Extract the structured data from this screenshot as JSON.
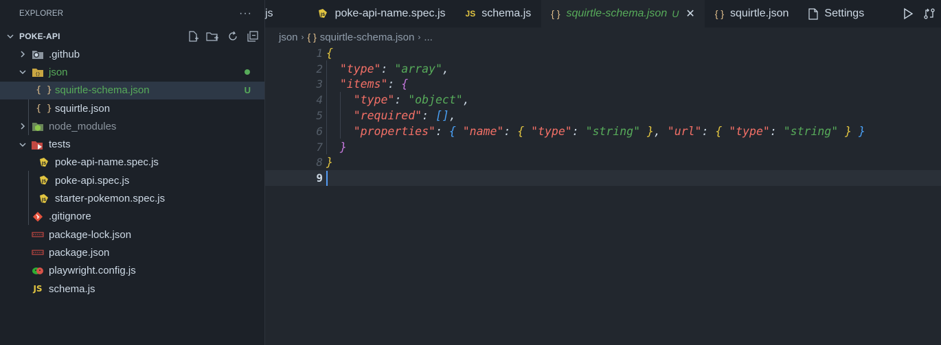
{
  "explorer": {
    "title": "EXPLORER",
    "more": "···",
    "project": "POKE-API"
  },
  "tree": [
    {
      "label": ".github",
      "kind": "folder",
      "icon": "github-folder-icon",
      "indent": 0,
      "twisty": "›"
    },
    {
      "label": "json",
      "kind": "folder-open",
      "icon": "json-folder-icon",
      "indent": 0,
      "twisty": "⌄",
      "status": "dot"
    },
    {
      "label": "squirtle-schema.json",
      "kind": "file",
      "icon": "json-file-icon",
      "indent": 1,
      "status": "U",
      "selected": true
    },
    {
      "label": "squirtle.json",
      "kind": "file",
      "icon": "json-file-icon",
      "indent": 1
    },
    {
      "label": "node_modules",
      "kind": "folder",
      "icon": "node-folder-icon",
      "indent": 0,
      "twisty": "›",
      "dim": true
    },
    {
      "label": "tests",
      "kind": "folder-open",
      "icon": "tests-folder-icon",
      "indent": 0,
      "twisty": "⌄"
    },
    {
      "label": "poke-api-name.spec.js",
      "kind": "file",
      "icon": "spec-file-icon",
      "indent": 1
    },
    {
      "label": "poke-api.spec.js",
      "kind": "file",
      "icon": "spec-file-icon",
      "indent": 1
    },
    {
      "label": "starter-pokemon.spec.js",
      "kind": "file",
      "icon": "spec-file-icon",
      "indent": 1
    },
    {
      "label": ".gitignore",
      "kind": "file",
      "icon": "git-file-icon",
      "indent": 0
    },
    {
      "label": "package-lock.json",
      "kind": "file",
      "icon": "npm-file-icon",
      "indent": 0
    },
    {
      "label": "package.json",
      "kind": "file",
      "icon": "npm-file-icon",
      "indent": 0
    },
    {
      "label": "playwright.config.js",
      "kind": "file",
      "icon": "playwright-file-icon",
      "indent": 0
    },
    {
      "label": "schema.js",
      "kind": "file",
      "icon": "js-file-icon",
      "indent": 0
    }
  ],
  "tabs": [
    {
      "label": "js",
      "icon": "",
      "partial": true
    },
    {
      "label": "poke-api-name.spec.js",
      "icon": "spec-file-icon"
    },
    {
      "label": "schema.js",
      "icon": "js-file-icon",
      "icon_text": "JS"
    },
    {
      "label": "squirtle-schema.json",
      "icon": "json-file-icon",
      "icon_text": "{ }",
      "active": true,
      "status": "U",
      "close": "✕"
    },
    {
      "label": "squirtle.json",
      "icon": "json-file-icon",
      "icon_text": "{ }"
    },
    {
      "label": "Settings",
      "icon": "settings-file-icon"
    }
  ],
  "breadcrumb": {
    "folder": "json",
    "file_icon": "{ }",
    "file": "squirtle-schema.json",
    "more": "..."
  },
  "editor": {
    "line_numbers": [
      "1",
      "2",
      "3",
      "4",
      "5",
      "6",
      "7",
      "8",
      "9"
    ],
    "active_line": "9"
  },
  "colors": {
    "key": "#f47067",
    "string": "#57ab5a",
    "bracket1": "#e2c541",
    "bracket2": "#c678dd",
    "bracket3": "#4aa1f7",
    "untracked": "#57ab5a"
  }
}
